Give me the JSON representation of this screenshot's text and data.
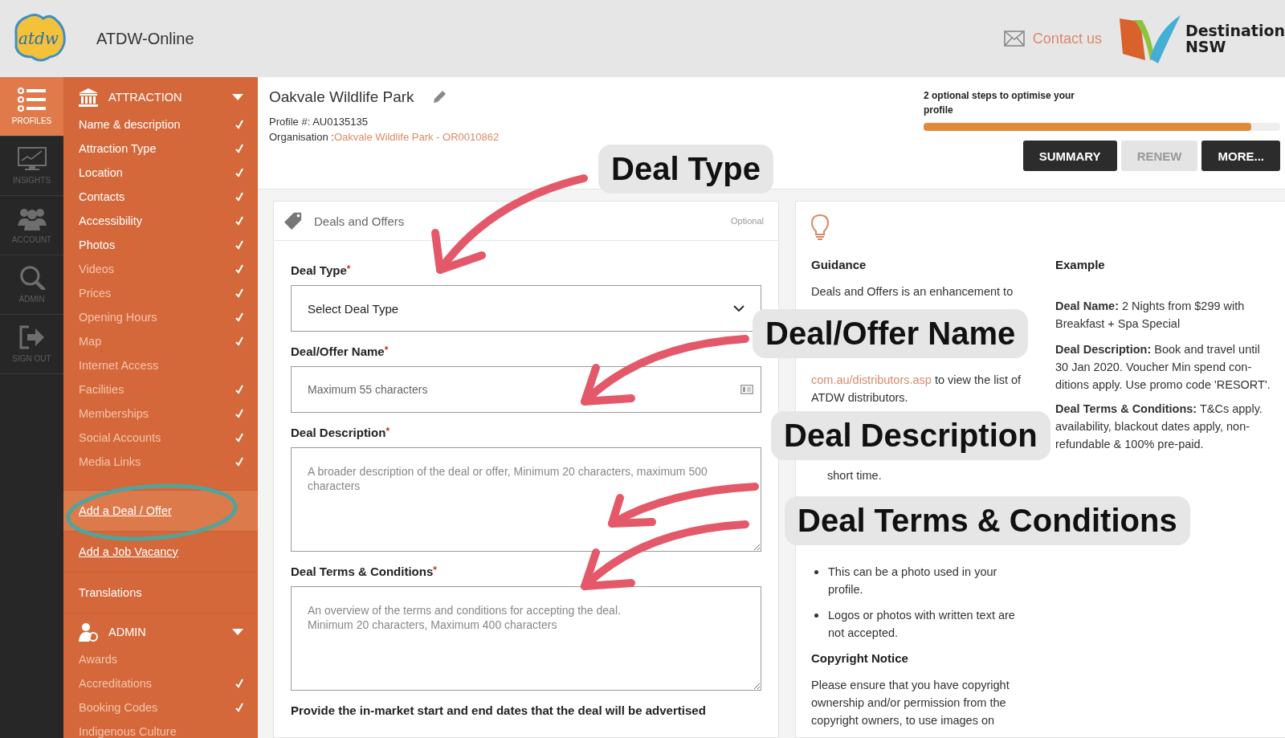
{
  "header": {
    "logo_text": "atdw",
    "title": "ATDW-Online",
    "contact": "Contact us",
    "partner_logo": [
      "Destination",
      "NSW"
    ]
  },
  "rail": [
    {
      "kind": "list",
      "label": "PROFILES",
      "selected": true
    },
    {
      "kind": "chart",
      "label": "INSIGHTS",
      "selected": false
    },
    {
      "kind": "people",
      "label": "ACCOUNT",
      "selected": false
    },
    {
      "kind": "search",
      "label": "ADMIN",
      "selected": false
    },
    {
      "kind": "signout",
      "label": "SIGN OUT",
      "selected": false
    }
  ],
  "sidebar": [
    {
      "kind": "section",
      "label": "ATTRACTION",
      "expanded": true
    },
    {
      "kind": "item",
      "label": "Name & description",
      "done": true,
      "muted": false
    },
    {
      "kind": "item",
      "label": "Attraction Type",
      "done": true,
      "muted": false
    },
    {
      "kind": "item",
      "label": "Location",
      "done": true,
      "muted": false
    },
    {
      "kind": "item",
      "label": "Contacts",
      "done": true,
      "muted": false
    },
    {
      "kind": "item",
      "label": "Accessibility",
      "done": true,
      "muted": false
    },
    {
      "kind": "item",
      "label": "Photos",
      "done": true,
      "muted": false
    },
    {
      "kind": "item",
      "label": "Videos",
      "done": true,
      "muted": true
    },
    {
      "kind": "item",
      "label": "Prices",
      "done": true,
      "muted": true
    },
    {
      "kind": "item",
      "label": "Opening Hours",
      "done": true,
      "muted": true
    },
    {
      "kind": "item",
      "label": "Map",
      "done": true,
      "muted": true
    },
    {
      "kind": "item",
      "label": "Internet Access",
      "done": false,
      "muted": true
    },
    {
      "kind": "item",
      "label": "Facilities",
      "done": true,
      "muted": true
    },
    {
      "kind": "item",
      "label": "Memberships",
      "done": true,
      "muted": true
    },
    {
      "kind": "item",
      "label": "Social Accounts",
      "done": true,
      "muted": true
    },
    {
      "kind": "item",
      "label": "Media Links",
      "done": true,
      "muted": true
    },
    {
      "kind": "link",
      "label": "Add a Deal / Offer",
      "selected": true
    },
    {
      "kind": "link",
      "label": "Add a Job Vacancy",
      "selected": false
    },
    {
      "kind": "plain",
      "label": "Translations"
    },
    {
      "kind": "section",
      "label": "ADMIN",
      "expanded": true
    },
    {
      "kind": "item",
      "label": "Awards",
      "done": false,
      "muted": true
    },
    {
      "kind": "item",
      "label": "Accreditations",
      "done": true,
      "muted": true
    },
    {
      "kind": "item",
      "label": "Booking Codes",
      "done": true,
      "muted": true
    },
    {
      "kind": "item",
      "label": "Indigenous Culture",
      "done": false,
      "muted": true
    }
  ],
  "profile": {
    "name": "Oakvale Wildlife Park",
    "profile_number": "Profile #: AU0135135",
    "organisation_label": "Organisation : ",
    "organisation_link": "Oakvale Wildlife Park - OR0010862"
  },
  "progress": {
    "text": "2 optional steps to optimise your profile",
    "level": 0.92
  },
  "actions": [
    {
      "label": "SUMMARY",
      "disabled": false
    },
    {
      "label": "RENEW",
      "disabled": true
    },
    {
      "label": "MORE...",
      "disabled": false
    }
  ],
  "form": {
    "title": "Deals and Offers",
    "badge": "Optional",
    "required_mark": "*",
    "fields": [
      {
        "kind": "select",
        "label": "Deal Type",
        "required": true,
        "value": "Select Deal Type"
      },
      {
        "kind": "input",
        "label": "Deal/Offer Name",
        "required": true,
        "placeholder": "Maximum 55 characters"
      },
      {
        "kind": "textarea",
        "label": "Deal Description",
        "required": true,
        "placeholder": "A broader description of the deal or offer, Minimum 20 characters, maximum 500 characters"
      },
      {
        "kind": "textarea",
        "label": "Deal Terms & Conditions",
        "required": true,
        "placeholder": "An overview of the terms and conditions for accepting the deal.\nMinimum 20 characters, Maximum 400 characters"
      }
    ],
    "footer_text": "Provide the in-market start and end dates that the deal will be advertised"
  },
  "guidance": [
    {
      "kind": "heading",
      "text": "Guidance"
    },
    {
      "kind": "para",
      "text": "Deals and Offers is an enhancement to"
    },
    {
      "kind": "link-para",
      "link": "com.au/distributors.asp",
      "text": " to view the list of ATDW distributors."
    },
    {
      "kind": "cont",
      "text": "short time."
    },
    {
      "kind": "bullet",
      "text": "This can be a photo used in your profile."
    },
    {
      "kind": "bullet",
      "text": "Logos or photos with written text are not accepted."
    },
    {
      "kind": "heading",
      "text": "Copyright Notice"
    },
    {
      "kind": "para",
      "text": "Please ensure that you have copyright ownership and/or permission from the copyright owners, to use images on"
    }
  ],
  "example": [
    {
      "kind": "heading",
      "text": "Example"
    },
    {
      "kind": "para",
      "text": "**Deal Name:** 2 Nights from $299 with"
    },
    {
      "kind": "line",
      "text": "Breakfast + Spa Special"
    },
    {
      "kind": "para",
      "text": "**Deal Description:** Book and travel until 30 Jan 2020. Voucher Min spend con-ditions apply. Use promo code 'RESORT'."
    },
    {
      "kind": "para",
      "text": "**Deal Terms & Conditions:** T&Cs apply."
    },
    {
      "kind": "line",
      "text": "availability, blackout dates apply, non-refundable & 100% pre-paid."
    }
  ],
  "callouts": [
    "Deal Type",
    "Deal/Offer Name",
    "Deal Description",
    "Deal Terms & Conditions"
  ]
}
